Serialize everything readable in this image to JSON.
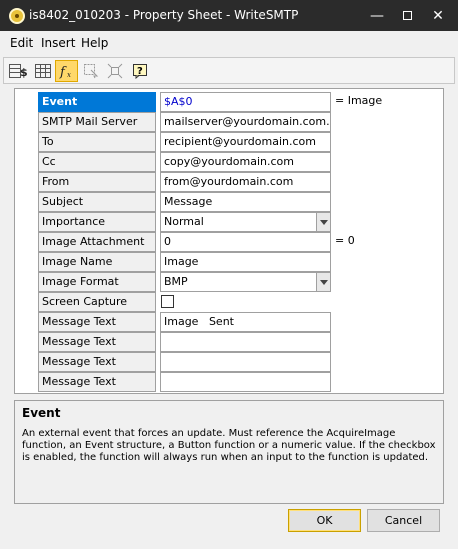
{
  "window": {
    "title": "is8402_010203 - Property Sheet - WriteSMTP",
    "minimize_glyph": "—",
    "close_glyph": "✕"
  },
  "menu": [
    "Edit",
    "Insert",
    "Help"
  ],
  "toolbar": {
    "icons": [
      "table-dollar-icon",
      "grid-icon",
      "function-icon",
      "select-icon",
      "resize-icon",
      "help-icon"
    ],
    "active_icon": "function-icon",
    "accent_color": "#ffd86a"
  },
  "properties": [
    {
      "label": "Event",
      "value": "$A$0",
      "note": "= Image"
    },
    {
      "label": "SMTP Mail Server",
      "value": "mailserver@yourdomain.com."
    },
    {
      "label": "To",
      "value": "recipient@yourdomain.com"
    },
    {
      "label": "Cc",
      "value": "copy@yourdomain.com"
    },
    {
      "label": "From",
      "value": "from@yourdomain.com"
    },
    {
      "label": "Subject",
      "value": "Message"
    },
    {
      "label": "Importance",
      "value": "Normal"
    },
    {
      "label": "Image Attachment",
      "value": "0",
      "note": "= 0"
    },
    {
      "label": "Image Name",
      "value": "Image"
    },
    {
      "label": "Image Format",
      "value": "BMP"
    },
    {
      "label": "Screen Capture",
      "value": ""
    },
    {
      "label": "Message Text",
      "value": "Image   Sent"
    },
    {
      "label": "Message Text",
      "value": ""
    },
    {
      "label": "Message Text",
      "value": ""
    },
    {
      "label": "Message Text",
      "value": ""
    }
  ],
  "description": {
    "title": "Event",
    "text": "An external event that forces an update. Must reference the AcquireImage function, an Event structure, a Button function or a numeric value. If the checkbox is enabled, the function will always run when an input to the function is updated."
  },
  "buttons": {
    "ok": "OK",
    "cancel": "Cancel"
  },
  "colors": {
    "selection": "#0078d7",
    "titlebar": "#2b2b2b",
    "event_value": "#0000cc"
  }
}
